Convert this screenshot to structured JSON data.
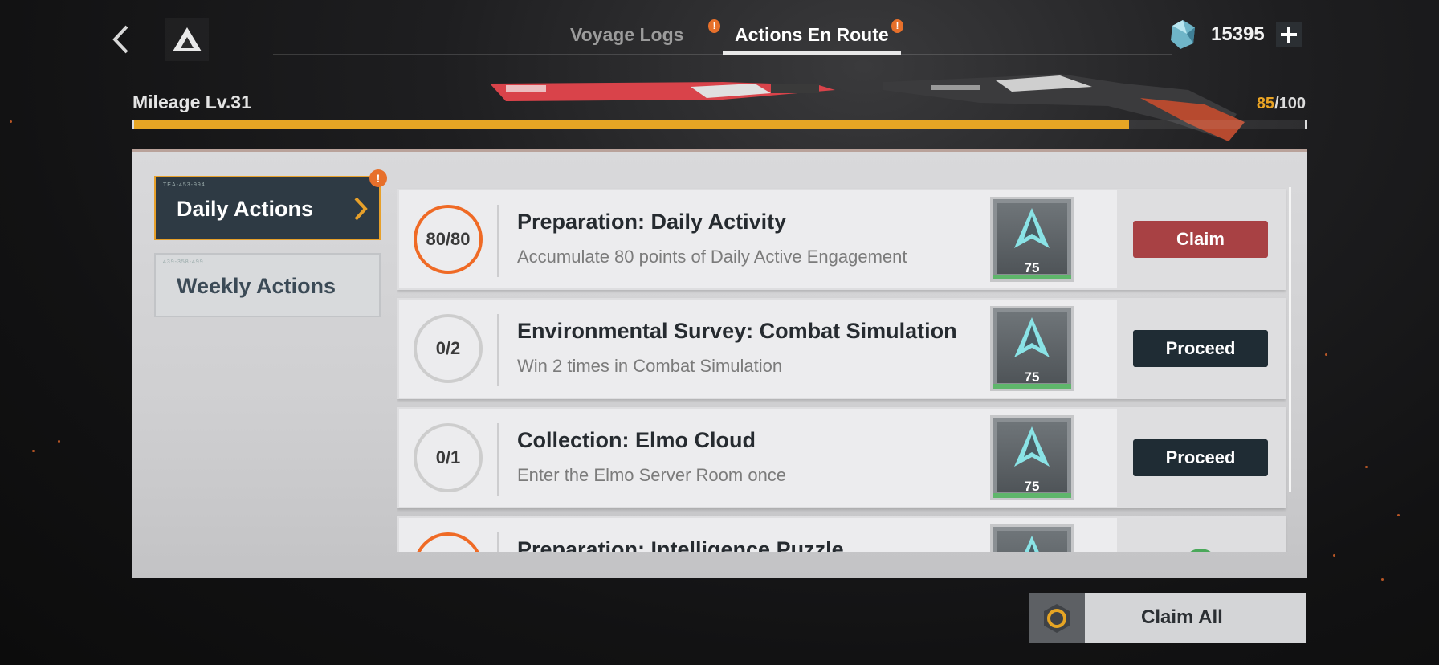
{
  "header": {
    "tabs": [
      {
        "label": "Voyage Logs",
        "active": false,
        "alert": "!"
      },
      {
        "label": "Actions En Route",
        "active": true,
        "alert": "!"
      }
    ],
    "currency": {
      "value": "15395",
      "icon": "crystal-icon",
      "add_icon": "plus-icon"
    }
  },
  "mileage": {
    "label": "Mileage Lv.31",
    "current": "85",
    "max": "/100",
    "progress": 0.85
  },
  "sidebar": {
    "items": [
      {
        "label": "Daily Actions",
        "code": "TEA-453-994",
        "active": true,
        "alert": "!"
      },
      {
        "label": "Weekly Actions",
        "code": "439-358-499",
        "active": false
      }
    ]
  },
  "tasks": [
    {
      "progress": "80/80",
      "title": "Preparation: Daily Activity",
      "desc": "Accumulate 80 points of Daily Active Engagement",
      "reward": "75",
      "button": "Claim"
    },
    {
      "progress": "0/2",
      "title": "Environmental Survey: Combat Simulation",
      "desc": "Win 2 times in Combat Simulation",
      "reward": "75",
      "button": "Proceed"
    },
    {
      "progress": "0/1",
      "title": "Collection: Elmo Cloud",
      "desc": "Enter the Elmo Server Room once",
      "reward": "75",
      "button": "Proceed"
    },
    {
      "title": "Preparation: Intelligence Puzzle"
    }
  ],
  "claim_all": {
    "label": "Claim All"
  },
  "colors": {
    "accent": "#e6a524",
    "claim": "#a84144",
    "proceed": "#1f2c34",
    "ring_done": "#ef6a25"
  }
}
